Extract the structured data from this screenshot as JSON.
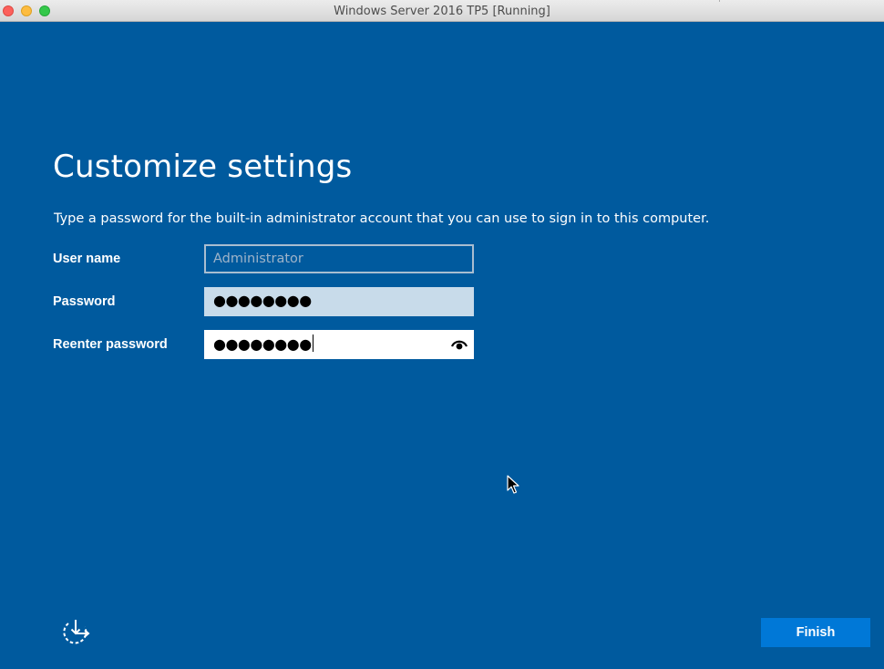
{
  "window": {
    "title": "Windows Server 2016 TP5 [Running]"
  },
  "setup": {
    "heading": "Customize settings",
    "description": "Type a password for the built-in administrator account that you can use to sign in to this computer.",
    "fields": {
      "username": {
        "label": "User name",
        "placeholder": "Administrator"
      },
      "password": {
        "label": "Password",
        "masked_value": "●●●●●●●●"
      },
      "reenter": {
        "label": "Reenter password",
        "masked_value": "●●●●●●●●"
      }
    },
    "finish_label": "Finish"
  },
  "icons": {
    "reveal": "eye-icon",
    "ease_of_access": "ease-of-access-icon",
    "cursor": "mouse-pointer-icon"
  },
  "colors": {
    "background": "#005a9e",
    "accent_button": "#0078d7",
    "text": "#ffffff"
  }
}
